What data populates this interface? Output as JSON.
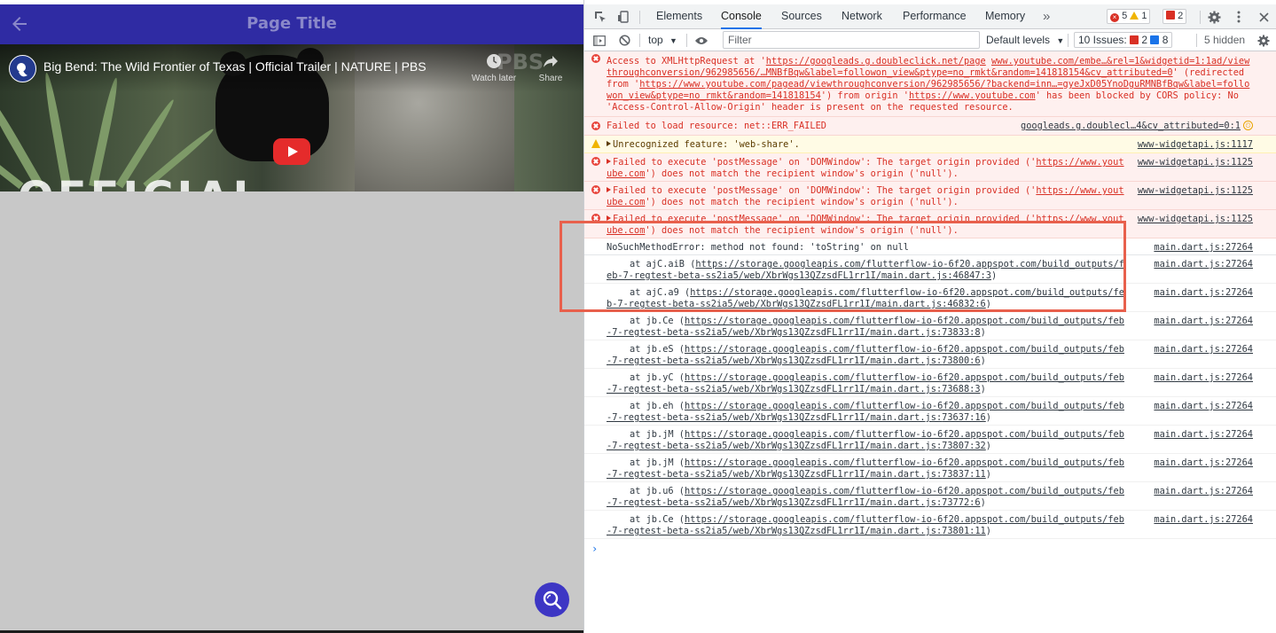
{
  "app": {
    "title": "Page Title",
    "video": {
      "title": "Big Bend: The Wild Frontier of Texas | Official Trailer | NATURE | PBS",
      "watch_later": "Watch later",
      "share": "Share",
      "overlay_text": "OFFICIAL"
    }
  },
  "devtools": {
    "tabs": [
      "Elements",
      "Console",
      "Sources",
      "Network",
      "Performance",
      "Memory"
    ],
    "active_tab": "Console",
    "more_tabs": "»",
    "counts": {
      "errors": "5",
      "warnings": "1",
      "issues": "2"
    },
    "toolbar": {
      "context": "top",
      "filter_placeholder": "Filter",
      "levels": "Default levels",
      "issues_label": "10 Issues:",
      "issues_red": "2",
      "issues_blue": "8",
      "hidden": "5 hidden"
    },
    "messages": [
      {
        "level": "error",
        "parts": [
          "Access to XMLHttpRequest at '",
          "https://googleads.g.doubleclick.net/page",
          " ",
          "www.youtube.com/embe…&rel=1&widgetid=1:1ad/viewthroughconversion/962985656/…MNBfBqw&label=followon_view&ptype=no_rmkt&random=141818154&cv_attributed=0",
          "' (redirected from '",
          "https://www.youtube.com/pagead/viewthroughconversion/962985656/?backend=inn…=gyeJxD05YnoDguRMNBfBqw&label=followon_view&ptype=no_rmkt&random=141818154",
          "') from origin '",
          "https://www.youtube.com",
          "' has been blocked by CORS policy: No 'Access-Control-Allow-Origin' header is present on the requested resource."
        ],
        "source": ""
      },
      {
        "level": "error",
        "text": "Failed to load resource: net::ERR_FAILED",
        "source": "googleads.g.doublecl…4&cv_attributed=0:1"
      },
      {
        "level": "warning",
        "text": "Unrecognized feature: 'web-share'.",
        "source": "www-widgetapi.js:1117"
      },
      {
        "level": "error",
        "pre": "Failed to execute 'postMessage' on 'DOMWindow': The target origin provided ('",
        "link": "https://www.youtube.com",
        "post": "') does not match the recipient window's origin ('null').",
        "source": "www-widgetapi.js:1125"
      },
      {
        "level": "error",
        "pre": "Failed to execute 'postMessage' on 'DOMWindow': The target origin provided ('",
        "link": "https://www.youtube.com",
        "post": "') does not match the recipient window's origin ('null').",
        "source": "www-widgetapi.js:1125"
      },
      {
        "level": "error",
        "pre": "Failed to execute 'postMessage' on 'DOMWindow': The target origin provided ('",
        "link": "https://www.youtube.com",
        "post": "') does not match the recipient window's origin ('null').",
        "source": "www-widgetapi.js:1125"
      },
      {
        "level": "plain",
        "text": "NoSuchMethodError: method not found: 'toString' on null",
        "source": "main.dart.js:27264"
      }
    ],
    "stack_prefix": "https://storage.googleapis.com/flutterflow-io-6f20.appspot.com/build_outputs/feb-7-regtest-beta-ss2ia5/web/XbrWgs13QZzsdFL1rr1I/main.dart.js:",
    "stack": [
      {
        "fn": "ajC.aiB",
        "loc": "46847:3",
        "source": "main.dart.js:27264"
      },
      {
        "fn": "ajC.a9",
        "loc": "46832:6",
        "source": "main.dart.js:27264"
      },
      {
        "fn": "jb.Ce",
        "loc": "73833:8",
        "source": "main.dart.js:27264"
      },
      {
        "fn": "jb.eS",
        "loc": "73800:6",
        "source": "main.dart.js:27264"
      },
      {
        "fn": "jb.yC",
        "loc": "73688:3",
        "source": "main.dart.js:27264"
      },
      {
        "fn": "jb.eh",
        "loc": "73637:16",
        "source": "main.dart.js:27264"
      },
      {
        "fn": "jb.jM",
        "loc": "73807:32",
        "source": "main.dart.js:27264"
      },
      {
        "fn": "jb.jM",
        "loc": "73837:11",
        "source": "main.dart.js:27264"
      },
      {
        "fn": "jb.u6",
        "loc": "73772:6",
        "source": "main.dart.js:27264"
      },
      {
        "fn": "jb.Ce",
        "loc": "73801:11",
        "source": "main.dart.js:27264"
      }
    ],
    "prompt": "›"
  },
  "colors": {
    "appbar": "#2f2ba3",
    "fab": "#3d36c4",
    "error_text": "#d93025",
    "highlight": "#e8604c"
  }
}
